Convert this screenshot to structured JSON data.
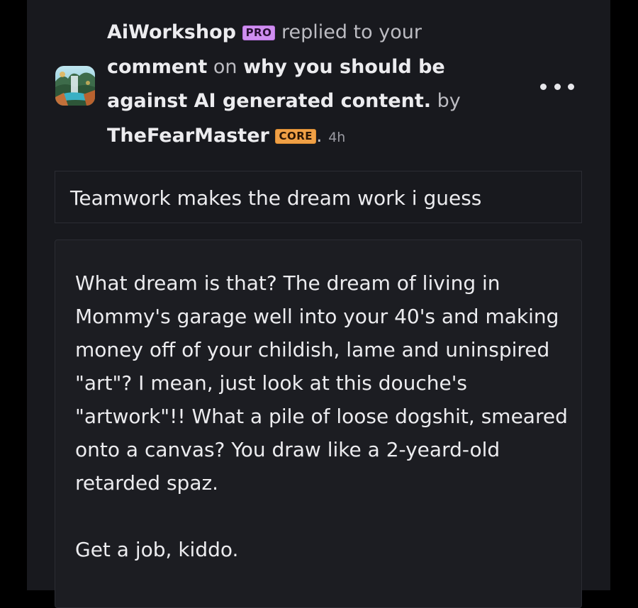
{
  "notification": {
    "actor_name": "AiWorkshop",
    "actor_badge": "PRO",
    "action_text": "replied to your",
    "object_text": "comment",
    "preposition": "on",
    "post_title": "why you should be against AI generated content.",
    "by_text": "by",
    "author_name": "TheFearMaster",
    "author_badge": "CORE",
    "separator": ".",
    "time_ago": "4h",
    "more_icon": "more-horizontal-icon"
  },
  "quoted_comment": {
    "text": "Teamwork makes the dream work i guess"
  },
  "reply": {
    "paragraph_1": "What dream is that? The dream of living in Mommy's garage well into your 40's and making money off of your childish, lame and uninspired \"art\"? I mean, just look at this douche's \"artwork\"!! What a pile of loose dogshit, smeared onto a canvas? You draw like a 2-yeard-old retarded spaz.",
    "paragraph_2": "Get a job, kiddo."
  },
  "colors": {
    "background": "#000000",
    "card": "#18191e",
    "pro_badge": "#cf8ef0",
    "core_badge": "#f0a046",
    "text_primary": "#ececef",
    "text_secondary": "#bcbcc2"
  }
}
